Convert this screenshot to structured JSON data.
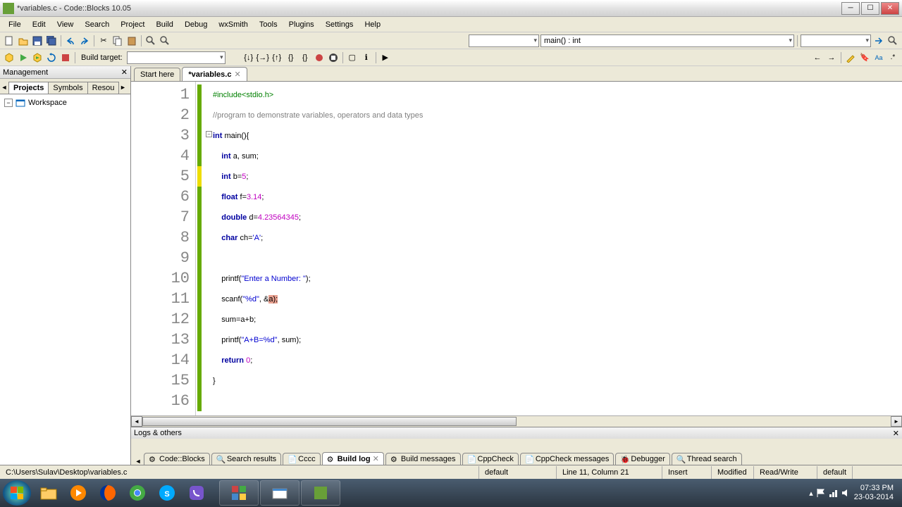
{
  "window": {
    "title": "*variables.c - Code::Blocks 10.05"
  },
  "menu": [
    "File",
    "Edit",
    "View",
    "Search",
    "Project",
    "Build",
    "Debug",
    "wxSmith",
    "Tools",
    "Plugins",
    "Settings",
    "Help"
  ],
  "toolbar2": {
    "build_target_label": "Build target:",
    "scope": "main() : int"
  },
  "management": {
    "title": "Management",
    "tabs": [
      "Projects",
      "Symbols",
      "Resou"
    ],
    "active_tab": 0,
    "tree": {
      "workspace": "Workspace"
    }
  },
  "editor": {
    "tabs": [
      {
        "label": "Start here",
        "active": false,
        "closable": false
      },
      {
        "label": "*variables.c",
        "active": true,
        "closable": true
      }
    ],
    "line_count": 16
  },
  "code": {
    "l1_pp": "#include<stdio.h>",
    "l2_cm": "//program to demonstrate variables, operators and data types",
    "l3_a": "int",
    "l3_b": " main(){",
    "l4_a": "    int",
    "l4_b": " a, sum;",
    "l5_a": "    int",
    "l5_b": " b=",
    "l5_c": "5",
    "l5_d": ";",
    "l6_a": "    float",
    "l6_b": " f=",
    "l6_c": "3.14",
    "l6_d": ";",
    "l7_a": "    double",
    "l7_b": " d=",
    "l7_c": "4.23564345",
    "l7_d": ";",
    "l8_a": "    char",
    "l8_b": " ch=",
    "l8_c": "'A'",
    "l8_d": ";",
    "l10_a": "    printf(",
    "l10_b": "\"Enter a Number: \"",
    "l10_c": ");",
    "l11_a": "    scanf(",
    "l11_b": "\"%d\"",
    "l11_c": ", &",
    "l11_hl": "a);",
    "l12": "    sum=a+b;",
    "l13_a": "    printf(",
    "l13_b": "\"A+B=%d\"",
    "l13_c": ", sum);",
    "l14_a": "    return",
    "l14_b": " ",
    "l14_c": "0",
    "l14_d": ";",
    "l15": "}",
    "fold": "−"
  },
  "logs": {
    "title": "Logs & others",
    "tabs": [
      "Code::Blocks",
      "Search results",
      "Cccc",
      "Build log",
      "Build messages",
      "CppCheck",
      "CppCheck messages",
      "Debugger",
      "Thread search"
    ],
    "active": 3
  },
  "status": {
    "path": "C:\\Users\\Sulav\\Desktop\\variables.c",
    "encoding": "default",
    "position": "Line 11, Column 21",
    "insert": "Insert",
    "modified": "Modified",
    "rw": "Read/Write",
    "extra": "default"
  },
  "tray": {
    "time": "07:33 PM",
    "date": "23-03-2014"
  }
}
